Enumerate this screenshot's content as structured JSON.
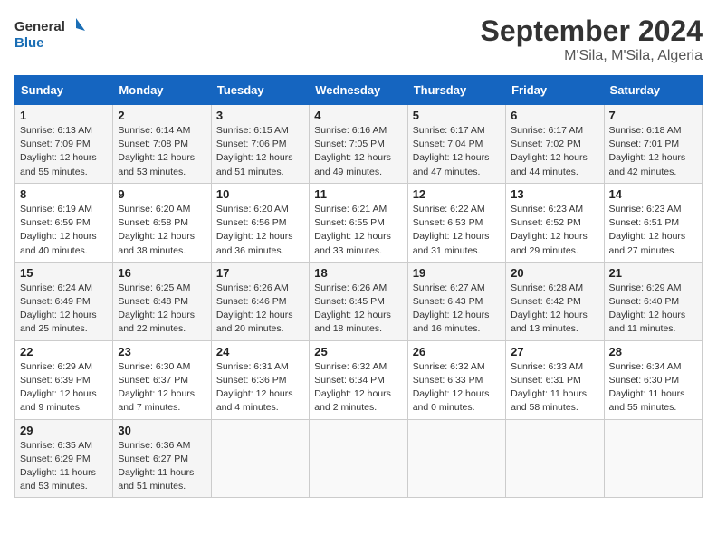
{
  "header": {
    "logo_line1": "General",
    "logo_line2": "Blue",
    "month": "September 2024",
    "location": "M'Sila, M'Sila, Algeria"
  },
  "days_of_week": [
    "Sunday",
    "Monday",
    "Tuesday",
    "Wednesday",
    "Thursday",
    "Friday",
    "Saturday"
  ],
  "weeks": [
    [
      {
        "day": "1",
        "info": "Sunrise: 6:13 AM\nSunset: 7:09 PM\nDaylight: 12 hours\nand 55 minutes."
      },
      {
        "day": "2",
        "info": "Sunrise: 6:14 AM\nSunset: 7:08 PM\nDaylight: 12 hours\nand 53 minutes."
      },
      {
        "day": "3",
        "info": "Sunrise: 6:15 AM\nSunset: 7:06 PM\nDaylight: 12 hours\nand 51 minutes."
      },
      {
        "day": "4",
        "info": "Sunrise: 6:16 AM\nSunset: 7:05 PM\nDaylight: 12 hours\nand 49 minutes."
      },
      {
        "day": "5",
        "info": "Sunrise: 6:17 AM\nSunset: 7:04 PM\nDaylight: 12 hours\nand 47 minutes."
      },
      {
        "day": "6",
        "info": "Sunrise: 6:17 AM\nSunset: 7:02 PM\nDaylight: 12 hours\nand 44 minutes."
      },
      {
        "day": "7",
        "info": "Sunrise: 6:18 AM\nSunset: 7:01 PM\nDaylight: 12 hours\nand 42 minutes."
      }
    ],
    [
      {
        "day": "8",
        "info": "Sunrise: 6:19 AM\nSunset: 6:59 PM\nDaylight: 12 hours\nand 40 minutes."
      },
      {
        "day": "9",
        "info": "Sunrise: 6:20 AM\nSunset: 6:58 PM\nDaylight: 12 hours\nand 38 minutes."
      },
      {
        "day": "10",
        "info": "Sunrise: 6:20 AM\nSunset: 6:56 PM\nDaylight: 12 hours\nand 36 minutes."
      },
      {
        "day": "11",
        "info": "Sunrise: 6:21 AM\nSunset: 6:55 PM\nDaylight: 12 hours\nand 33 minutes."
      },
      {
        "day": "12",
        "info": "Sunrise: 6:22 AM\nSunset: 6:53 PM\nDaylight: 12 hours\nand 31 minutes."
      },
      {
        "day": "13",
        "info": "Sunrise: 6:23 AM\nSunset: 6:52 PM\nDaylight: 12 hours\nand 29 minutes."
      },
      {
        "day": "14",
        "info": "Sunrise: 6:23 AM\nSunset: 6:51 PM\nDaylight: 12 hours\nand 27 minutes."
      }
    ],
    [
      {
        "day": "15",
        "info": "Sunrise: 6:24 AM\nSunset: 6:49 PM\nDaylight: 12 hours\nand 25 minutes."
      },
      {
        "day": "16",
        "info": "Sunrise: 6:25 AM\nSunset: 6:48 PM\nDaylight: 12 hours\nand 22 minutes."
      },
      {
        "day": "17",
        "info": "Sunrise: 6:26 AM\nSunset: 6:46 PM\nDaylight: 12 hours\nand 20 minutes."
      },
      {
        "day": "18",
        "info": "Sunrise: 6:26 AM\nSunset: 6:45 PM\nDaylight: 12 hours\nand 18 minutes."
      },
      {
        "day": "19",
        "info": "Sunrise: 6:27 AM\nSunset: 6:43 PM\nDaylight: 12 hours\nand 16 minutes."
      },
      {
        "day": "20",
        "info": "Sunrise: 6:28 AM\nSunset: 6:42 PM\nDaylight: 12 hours\nand 13 minutes."
      },
      {
        "day": "21",
        "info": "Sunrise: 6:29 AM\nSunset: 6:40 PM\nDaylight: 12 hours\nand 11 minutes."
      }
    ],
    [
      {
        "day": "22",
        "info": "Sunrise: 6:29 AM\nSunset: 6:39 PM\nDaylight: 12 hours\nand 9 minutes."
      },
      {
        "day": "23",
        "info": "Sunrise: 6:30 AM\nSunset: 6:37 PM\nDaylight: 12 hours\nand 7 minutes."
      },
      {
        "day": "24",
        "info": "Sunrise: 6:31 AM\nSunset: 6:36 PM\nDaylight: 12 hours\nand 4 minutes."
      },
      {
        "day": "25",
        "info": "Sunrise: 6:32 AM\nSunset: 6:34 PM\nDaylight: 12 hours\nand 2 minutes."
      },
      {
        "day": "26",
        "info": "Sunrise: 6:32 AM\nSunset: 6:33 PM\nDaylight: 12 hours\nand 0 minutes."
      },
      {
        "day": "27",
        "info": "Sunrise: 6:33 AM\nSunset: 6:31 PM\nDaylight: 11 hours\nand 58 minutes."
      },
      {
        "day": "28",
        "info": "Sunrise: 6:34 AM\nSunset: 6:30 PM\nDaylight: 11 hours\nand 55 minutes."
      }
    ],
    [
      {
        "day": "29",
        "info": "Sunrise: 6:35 AM\nSunset: 6:29 PM\nDaylight: 11 hours\nand 53 minutes."
      },
      {
        "day": "30",
        "info": "Sunrise: 6:36 AM\nSunset: 6:27 PM\nDaylight: 11 hours\nand 51 minutes."
      },
      {
        "day": "",
        "info": ""
      },
      {
        "day": "",
        "info": ""
      },
      {
        "day": "",
        "info": ""
      },
      {
        "day": "",
        "info": ""
      },
      {
        "day": "",
        "info": ""
      }
    ]
  ]
}
